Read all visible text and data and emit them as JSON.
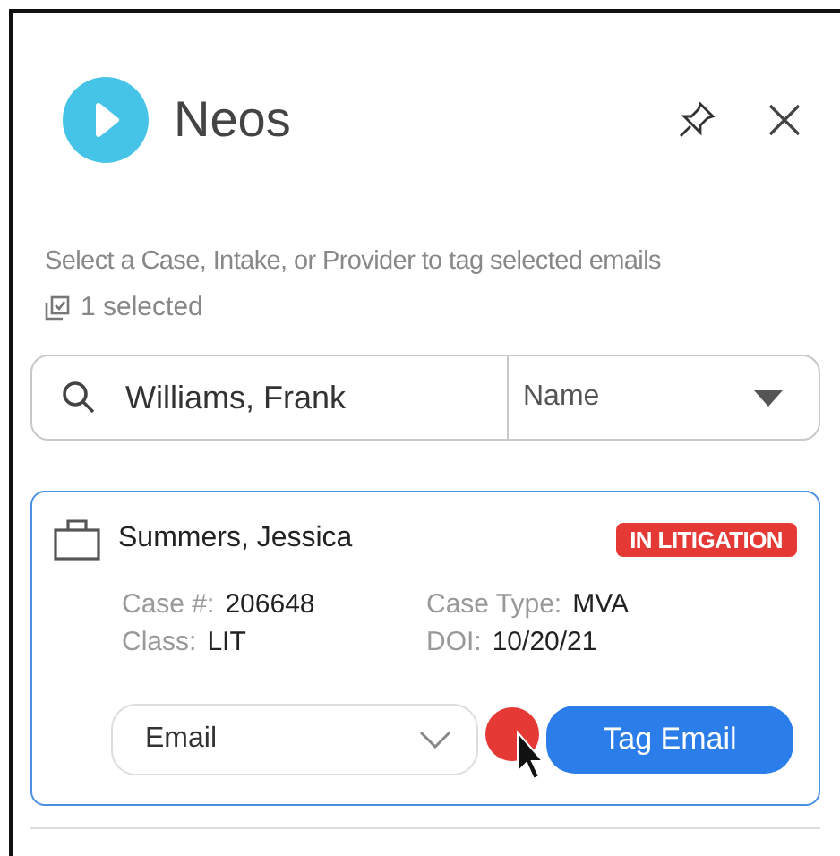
{
  "header": {
    "title": "Neos"
  },
  "instruction": "Select a Case, Intake, or Provider to tag selected emails",
  "selection": {
    "count_label": "1 selected"
  },
  "search": {
    "value": "Williams, Frank",
    "filter": "Name"
  },
  "cases": [
    {
      "name": "Summers, Jessica",
      "status": "IN LITIGATION",
      "color": "#e53935",
      "selected": true,
      "fields": [
        {
          "label": "Case #:",
          "value": "206648"
        },
        {
          "label": "Case Type:",
          "value": "MVA"
        },
        {
          "label": "Class:",
          "value": "LIT"
        },
        {
          "label": "DOI:",
          "value": "10/20/21"
        }
      ],
      "tag_type": "Email",
      "action": "Tag Email"
    }
  ]
}
